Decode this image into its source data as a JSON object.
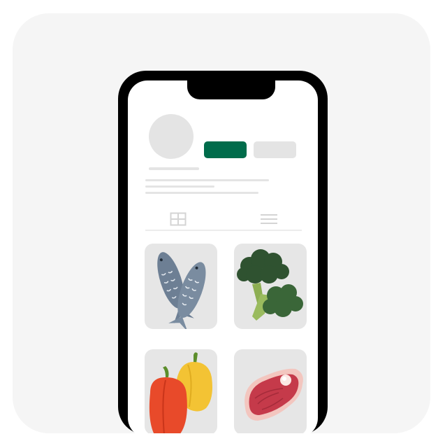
{
  "profile": {
    "avatar_icon": "avatar-placeholder",
    "primary_button_color": "#006c4b",
    "secondary_button_color": "#e4e4e4"
  },
  "tabs": [
    {
      "icon": "grid-icon"
    },
    {
      "icon": "list-icon"
    }
  ],
  "posts": [
    {
      "icon": "fish-icon"
    },
    {
      "icon": "broccoli-icon"
    },
    {
      "icon": "bell-peppers-icon"
    },
    {
      "icon": "steak-icon"
    }
  ]
}
